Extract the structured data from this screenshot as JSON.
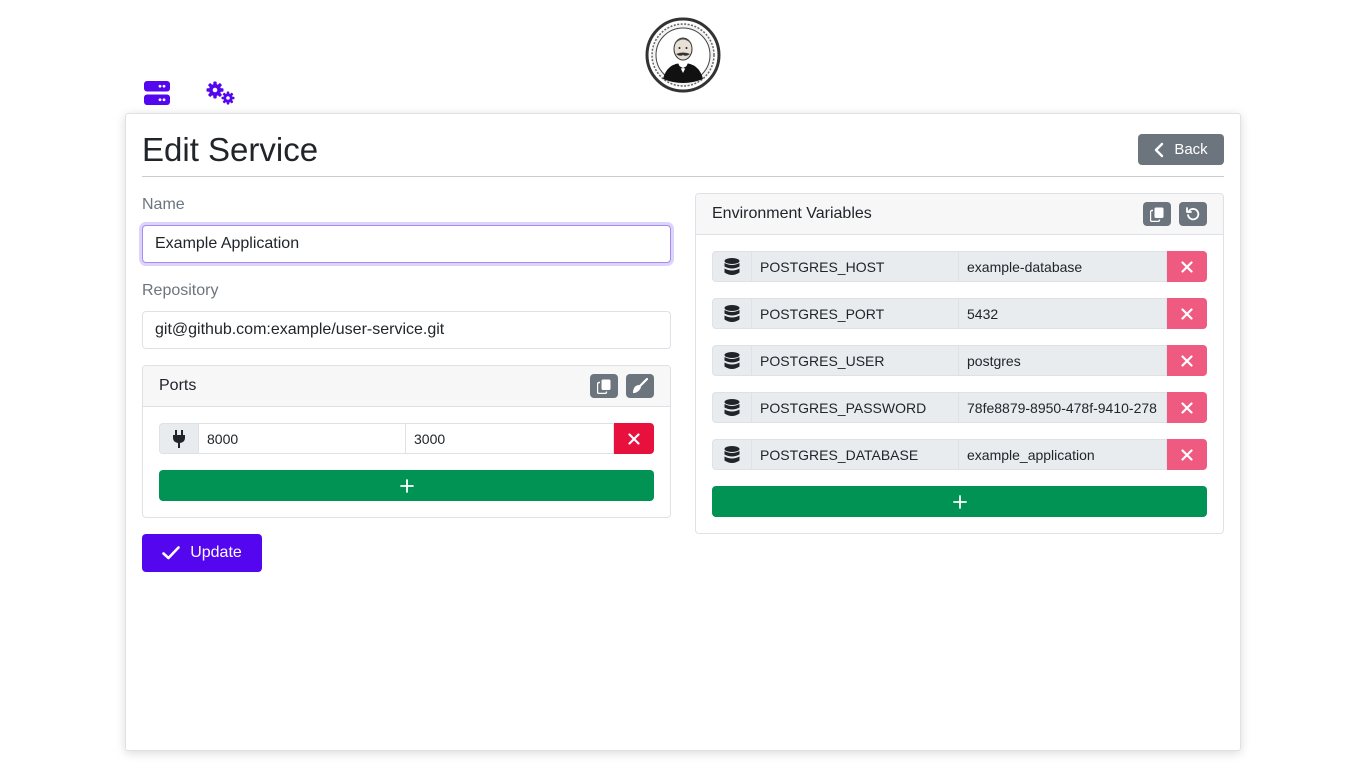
{
  "page": {
    "title": "Edit Service"
  },
  "header": {
    "back_label": "Back"
  },
  "form": {
    "name_label": "Name",
    "name_value": "Example Application",
    "repository_label": "Repository",
    "repository_value": "git@github.com:example/user-service.git",
    "update_label": "Update"
  },
  "ports": {
    "title": "Ports",
    "rows": [
      {
        "host": "8000",
        "container": "3000"
      }
    ]
  },
  "env": {
    "title": "Environment Variables",
    "rows": [
      {
        "key": "POSTGRES_HOST",
        "value": "example-database"
      },
      {
        "key": "POSTGRES_PORT",
        "value": "5432"
      },
      {
        "key": "POSTGRES_USER",
        "value": "postgres"
      },
      {
        "key": "POSTGRES_PASSWORD",
        "value": "78fe8879-8950-478f-9410-278"
      },
      {
        "key": "POSTGRES_DATABASE",
        "value": "example_application"
      }
    ]
  },
  "colors": {
    "primary": "#5406ef",
    "secondary": "#6c757d",
    "success": "#009353",
    "danger": "#e8113e",
    "danger_light": "#ef5b80"
  },
  "icons": {
    "nav_services": "server-icon",
    "nav_settings": "gears-icon",
    "port_row": "plug-icon",
    "env_row": "database-icon",
    "copy": "copy-icon",
    "clear": "broom-icon",
    "reset": "undo-icon",
    "remove": "close-icon",
    "add": "plus-icon",
    "update": "check-icon",
    "back": "chevron-left-icon"
  }
}
